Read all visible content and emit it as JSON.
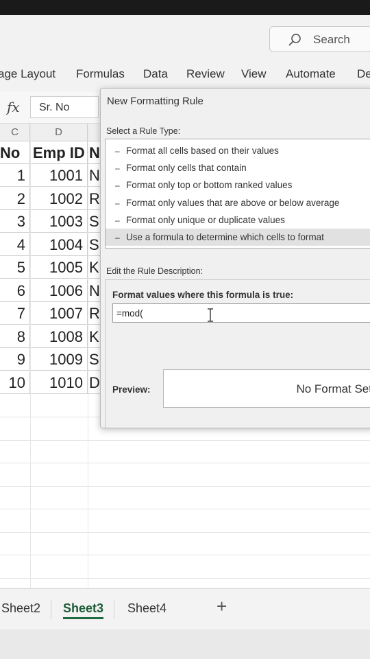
{
  "search": {
    "label": "Search"
  },
  "ribbon": {
    "tabs": [
      "age Layout",
      "Formulas",
      "Data",
      "Review",
      "View",
      "Automate",
      "De"
    ]
  },
  "formula_bar": {
    "fx": "fx",
    "cell_value": "Sr. No"
  },
  "grid": {
    "column_letters": [
      "C",
      "D"
    ],
    "header": {
      "no": "No",
      "emp_id": "Emp ID",
      "next": "N"
    },
    "rows": [
      {
        "no": "1",
        "emp_id": "1001",
        "next": "N"
      },
      {
        "no": "2",
        "emp_id": "1002",
        "next": "R"
      },
      {
        "no": "3",
        "emp_id": "1003",
        "next": "S"
      },
      {
        "no": "4",
        "emp_id": "1004",
        "next": "S"
      },
      {
        "no": "5",
        "emp_id": "1005",
        "next": "K"
      },
      {
        "no": "6",
        "emp_id": "1006",
        "next": "N"
      },
      {
        "no": "7",
        "emp_id": "1007",
        "next": "R"
      },
      {
        "no": "8",
        "emp_id": "1008",
        "next": "K"
      },
      {
        "no": "9",
        "emp_id": "1009",
        "next": "S"
      },
      {
        "no": "10",
        "emp_id": "1010",
        "next": "D"
      }
    ]
  },
  "dialog": {
    "title": "New Formatting Rule",
    "select_label": "Select a Rule Type:",
    "rule_types": [
      "Format all cells based on their values",
      "Format only cells that contain",
      "Format only top or bottom ranked values",
      "Format only values that are above or below average",
      "Format only unique or duplicate values",
      "Use a formula to determine which cells to format"
    ],
    "selected_rule_index": 5,
    "edit_label": "Edit the Rule Description:",
    "formula_label": "Format values where this formula is true:",
    "formula_value": "=mod(",
    "preview_label": "Preview:",
    "preview_text": "No Format Set"
  },
  "sheets": {
    "tabs": [
      "Sheet2",
      "Sheet3",
      "Sheet4"
    ],
    "active": "Sheet3",
    "add_label": "+"
  },
  "colors": {
    "active_sheet": "#1d6b40",
    "selected_rule_bg": "#e1e1e1"
  }
}
